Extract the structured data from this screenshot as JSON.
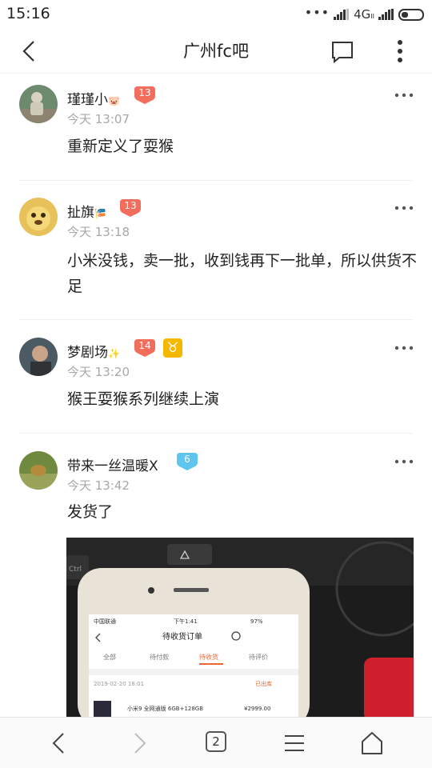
{
  "status_bar": {
    "time": "15:16",
    "network": "4G",
    "network_sub": "II"
  },
  "nav": {
    "title": "广州fc吧"
  },
  "posts": [
    {
      "username": "瑾瑾小",
      "badge_emoji": "🐷",
      "level": "13",
      "time": "今天 13:07",
      "content": "重新定义了耍猴"
    },
    {
      "username": "扯旗",
      "badge_emoji": "🎏",
      "level": "13",
      "time": "今天 13:18",
      "content": "小米没钱，卖一批，收到钱再下一批单，所以供货不足"
    },
    {
      "username": "梦剧场",
      "badge_emoji": "✨",
      "level": "14",
      "zodiac": "♉",
      "time": "今天 13:20",
      "content": "猴王耍猴系列继续上演"
    },
    {
      "username": "带来一丝温暖X",
      "level": "6",
      "time": "今天 13:42",
      "content": "发货了"
    }
  ],
  "photo": {
    "keyboard_key": "Ctrl",
    "phone_carrier": "中国联通",
    "phone_time": "下午1:41",
    "phone_battery": "97%",
    "phone_title": "待收货订单",
    "phone_tabs": [
      "全部",
      "待付款",
      "待收货",
      "待评价"
    ],
    "active_tab": "待收货",
    "order_date": "2019-02-20 18:01",
    "order_status": "已出库",
    "product": "小米9 全网通版 6GB+128GB",
    "price": "¥2999.00"
  },
  "toolbar": {
    "tab_count": "2"
  },
  "colors": {
    "level_red": "#f26d5b",
    "level_blue": "#5ec6ee",
    "zodiac": "#f5b800",
    "muted": "#a8a8a8"
  }
}
